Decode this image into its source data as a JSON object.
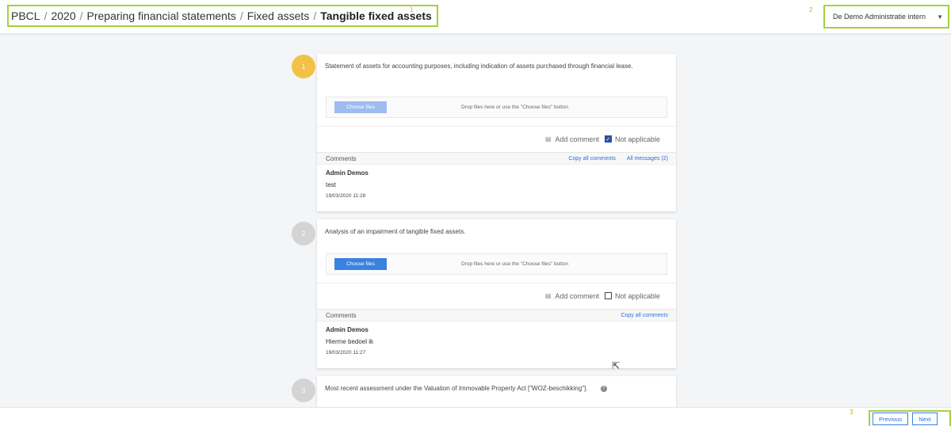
{
  "header": {
    "breadcrumb": [
      "PBCL",
      "2020",
      "Preparing financial statements",
      "Fixed assets"
    ],
    "breadcrumb_current": "Tangible fixed assets",
    "marker_1": "1",
    "marker_2": "2",
    "organization": "De Demo Administratie intern"
  },
  "items": [
    {
      "number": "1",
      "description": "Statement of assets for accounting purposes, including indication of assets purchased through financial lease.",
      "choose_files": "Choose files",
      "drop_hint": "Drop files here or use the \"Choose files\" button",
      "add_comment": "Add comment",
      "not_applicable": "Not applicable",
      "not_applicable_checked": true,
      "comments_label": "Comments",
      "copy_all": "Copy all comments",
      "all_messages": "All messages (2)",
      "comment": {
        "author": "Admin Demos",
        "text": "test",
        "time": "19/03/2020 11:28"
      }
    },
    {
      "number": "2",
      "description": "Analysis of an impairment of tangible fixed assets.",
      "choose_files": "Choose files",
      "drop_hint": "Drop files here or use the \"Choose files\" button",
      "add_comment": "Add comment",
      "not_applicable": "Not applicable",
      "not_applicable_checked": false,
      "comments_label": "Comments",
      "copy_all": "Copy all comments",
      "comment": {
        "author": "Admin Demos",
        "text": "Hierme bedoel ik",
        "time": "19/03/2020 11:27"
      }
    },
    {
      "number": "3",
      "description": "Most recent assessment under the Valuation of Immovable Property Act [\"WOZ-beschikking\"]."
    }
  ],
  "footer": {
    "marker_3": "3",
    "previous": "Previous",
    "next": "Next"
  },
  "colors": {
    "highlight": "#a4d23c",
    "active_step": "#f2c244",
    "primary": "#3b82e0"
  }
}
